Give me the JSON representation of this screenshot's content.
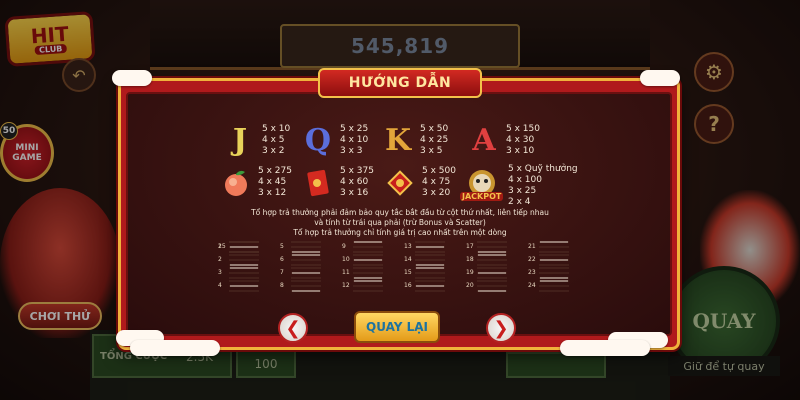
{
  "logo": {
    "main": "HIT",
    "sub": "CLUB"
  },
  "jackpot": {
    "value": "545,819"
  },
  "left_panel": {
    "mini_game": {
      "badge": "50",
      "label": "MINI GAME"
    },
    "try_label": "CHƠI THỬ"
  },
  "bottom": {
    "bet_label": "TỔNG CƯỢC",
    "bet_value": "2.5K",
    "coin_value": "100",
    "spin_label": "QUAY",
    "auto_spin_label": "Giữ để tự quay"
  },
  "modal": {
    "title": "HƯỚNG DẪN",
    "symbols": [
      {
        "name": "J",
        "color": "#e8d25a",
        "pays": [
          "5 x 10",
          "4 x 5",
          "3 x 2"
        ]
      },
      {
        "name": "Q",
        "color": "#5b6edb",
        "pays": [
          "5 x 25",
          "4 x 10",
          "3 x 3"
        ]
      },
      {
        "name": "K",
        "color": "#e2a53a",
        "pays": [
          "5 x 50",
          "4 x 25",
          "3 x 5"
        ]
      },
      {
        "name": "A",
        "color": "#e04040",
        "pays": [
          "5 x 150",
          "4 x 30",
          "3 x 10"
        ]
      },
      {
        "name": "peach",
        "icon": "peach-icon",
        "pays": [
          "5 x 275",
          "4 x 45",
          "3 x 12"
        ]
      },
      {
        "name": "red-envelope",
        "icon": "red-envelope-icon",
        "pays": [
          "5 x 375",
          "4 x 60",
          "3 x 16"
        ]
      },
      {
        "name": "firecracker",
        "icon": "firecracker-icon",
        "pays": [
          "5 x 500",
          "4 x 75",
          "3 x 20"
        ]
      },
      {
        "name": "jackpot",
        "icon": "jackpot-icon",
        "label": "JACKPOT",
        "pays": [
          "5 x Quỹ thưởng",
          "4 x 100",
          "3 x 25",
          "2 x 4"
        ]
      }
    ],
    "rules": [
      "Tổ hợp trả thưởng phải đảm bảo quy tắc bắt đầu từ cột thứ nhất, liên tiếp nhau",
      "và tính từ trái qua phải (trừ Bonus và Scatter)",
      "Tổ hợp trả thưởng chỉ tính giá trị cao nhất trên một dòng"
    ],
    "lines": [
      1,
      2,
      3,
      4,
      5,
      6,
      7,
      8,
      9,
      10,
      11,
      12,
      13,
      14,
      15,
      16,
      17,
      18,
      19,
      20,
      21,
      22,
      23,
      24,
      25
    ],
    "back_label": "QUAY LẠI"
  },
  "colors": {
    "frame": "#b01a1c",
    "gold": "#f0b23c",
    "accent_blue": "#1e73a0"
  }
}
